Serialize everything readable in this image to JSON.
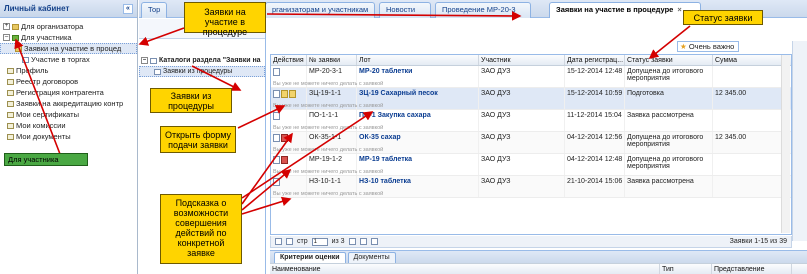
{
  "sidebar": {
    "title": "Личный кабинет",
    "collapse": "«",
    "items": [
      {
        "label": "Для организатора",
        "exp": "+"
      },
      {
        "label": "Для участника",
        "exp": "–"
      },
      {
        "label": "Заявки на участие в процед"
      },
      {
        "label": "Участие в торгах"
      },
      {
        "label": "Профиль"
      },
      {
        "label": "Реестр договоров"
      },
      {
        "label": "Регистрация контрагента"
      },
      {
        "label": "Заявки на аккредитацию контр"
      },
      {
        "label": "Мои сертификаты"
      },
      {
        "label": "Мои комиссии"
      },
      {
        "label": "Мои документы"
      }
    ]
  },
  "tabs": [
    {
      "label": "Тор"
    },
    {
      "label": "рганизаторам и участникам"
    },
    {
      "label": "Новости"
    },
    {
      "label": "Проведение МР-20-3"
    },
    {
      "label": "Заявки на участие в процедуре",
      "close": "×"
    }
  ],
  "midpanel": {
    "root": "Каталоги раздела \"Заявки на",
    "child": "Заявки из процедуры"
  },
  "important": {
    "star": "★",
    "label": "Очень важно"
  },
  "grid": {
    "columns": [
      "Действия",
      "№ заявки",
      "Лот",
      "Участник",
      "Дата регистрац...",
      "Статус заявки",
      "Сумма"
    ],
    "hint": "Вы уже не можете ничего делать с заявкой",
    "hint_edit": "Вы уже не можете ничего делать с заявкой",
    "rows": [
      {
        "num": "МР-20-3-1",
        "lot": "МР-20 таблетки",
        "participant": "ЗАО ДУЗ",
        "date": "15-12-2014 12:48",
        "status": "Допущена до итогового мероприятия",
        "sum": ""
      },
      {
        "num": "ЗЦ-19-1-1",
        "lot": "ЗЦ-19 Сахарный песок",
        "participant": "ЗАО ДУЗ",
        "date": "15-12-2014 10:59",
        "status": "Подготовка",
        "sum": "12 345.00"
      },
      {
        "num": "ПО-1-1-1",
        "lot": "ПО-1 Закупка сахара",
        "participant": "ЗАО ДУЗ",
        "date": "11-12-2014 15:04",
        "status": "Заявка рассмотрена",
        "sum": ""
      },
      {
        "num": "ОК-35-1-1",
        "lot": "ОК-35 сахар",
        "participant": "ЗАО ДУЗ",
        "date": "04-12-2014 12:56",
        "status": "Допущена до итогового мероприятия",
        "sum": "12 345.00"
      },
      {
        "num": "МР-19-1-2",
        "lot": "МР-19 таблетка",
        "participant": "ЗАО ДУЗ",
        "date": "04-12-2014 12:48",
        "status": "Допущена до итогового мероприятия",
        "sum": ""
      },
      {
        "num": "НЗ-10-1-1",
        "lot": "НЗ-10 таблетка",
        "participant": "ЗАО ДУЗ",
        "date": "21-10-2014 15:06",
        "status": "Заявка рассмотрена",
        "sum": ""
      }
    ]
  },
  "pager": {
    "page_label": "стр",
    "page": "1",
    "of": "из 3",
    "summary": "Заявки 1-15 из 39"
  },
  "bottom": {
    "tabs": [
      "Критерии оценки",
      "Документы"
    ],
    "columns": [
      "Наименование",
      "Тип",
      "Представление"
    ]
  },
  "callouts": {
    "tab_annotation": "Заявки на участие в процедуре",
    "status": "Статус заявки",
    "proc_apps": "Заявки из процедуры",
    "open_form": "Открыть форму подачи заявки",
    "hint_actions": "Подсказка о возможности совершения действий по конкретной заявке",
    "for_participant": "Для участника"
  },
  "colors": {
    "callout": "#ffd400",
    "callout_green": "#4aa843",
    "arrow": "#d40000"
  }
}
